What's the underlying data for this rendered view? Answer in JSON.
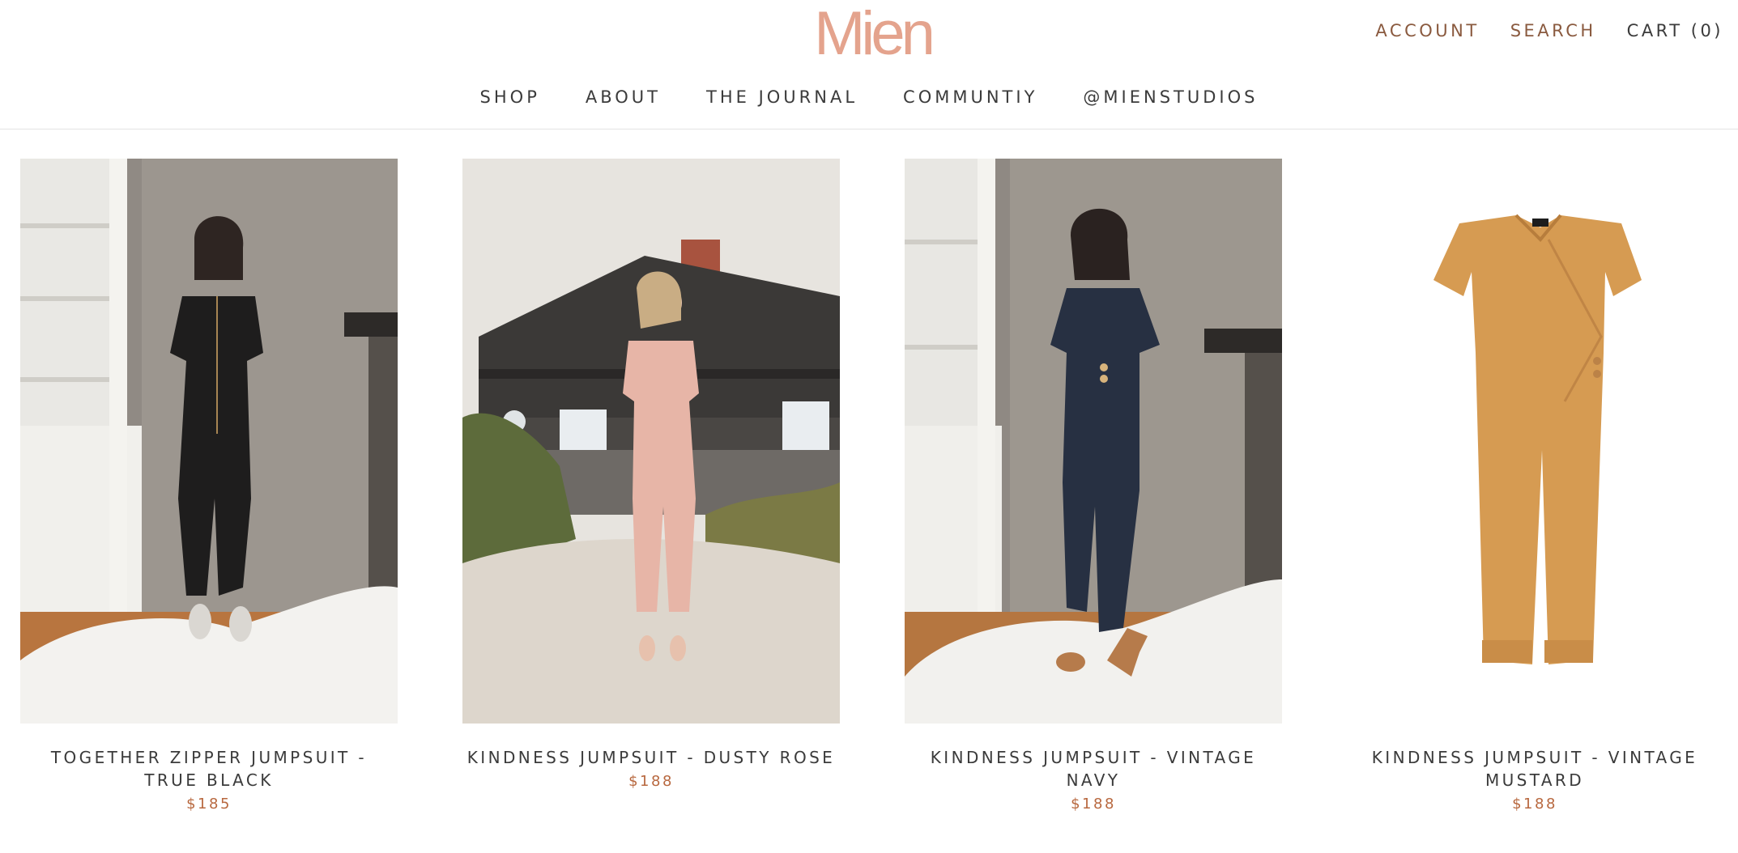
{
  "brand": {
    "logo_text": "Mien"
  },
  "util_nav": {
    "account": "ACCOUNT",
    "search": "SEARCH",
    "cart": "CART (0)"
  },
  "main_nav": {
    "items": [
      "SHOP",
      "ABOUT",
      "THE JOURNAL",
      "COMMUNTIY",
      "@MIENSTUDIOS"
    ]
  },
  "products": [
    {
      "name": "TOGETHER ZIPPER JUMPSUIT - TRUE BLACK",
      "price": "$185"
    },
    {
      "name": "KINDNESS JUMPSUIT - DUSTY ROSE",
      "price": "$188"
    },
    {
      "name": "KINDNESS JUMPSUIT - VINTAGE NAVY",
      "price": "$188"
    },
    {
      "name": "KINDNESS JUMPSUIT - VINTAGE MUSTARD",
      "price": "$188"
    }
  ],
  "colors": {
    "logo": "#e4a38d",
    "accent_link": "#8a5a3f",
    "price": "#b8683f",
    "text": "#3b3b3b"
  }
}
